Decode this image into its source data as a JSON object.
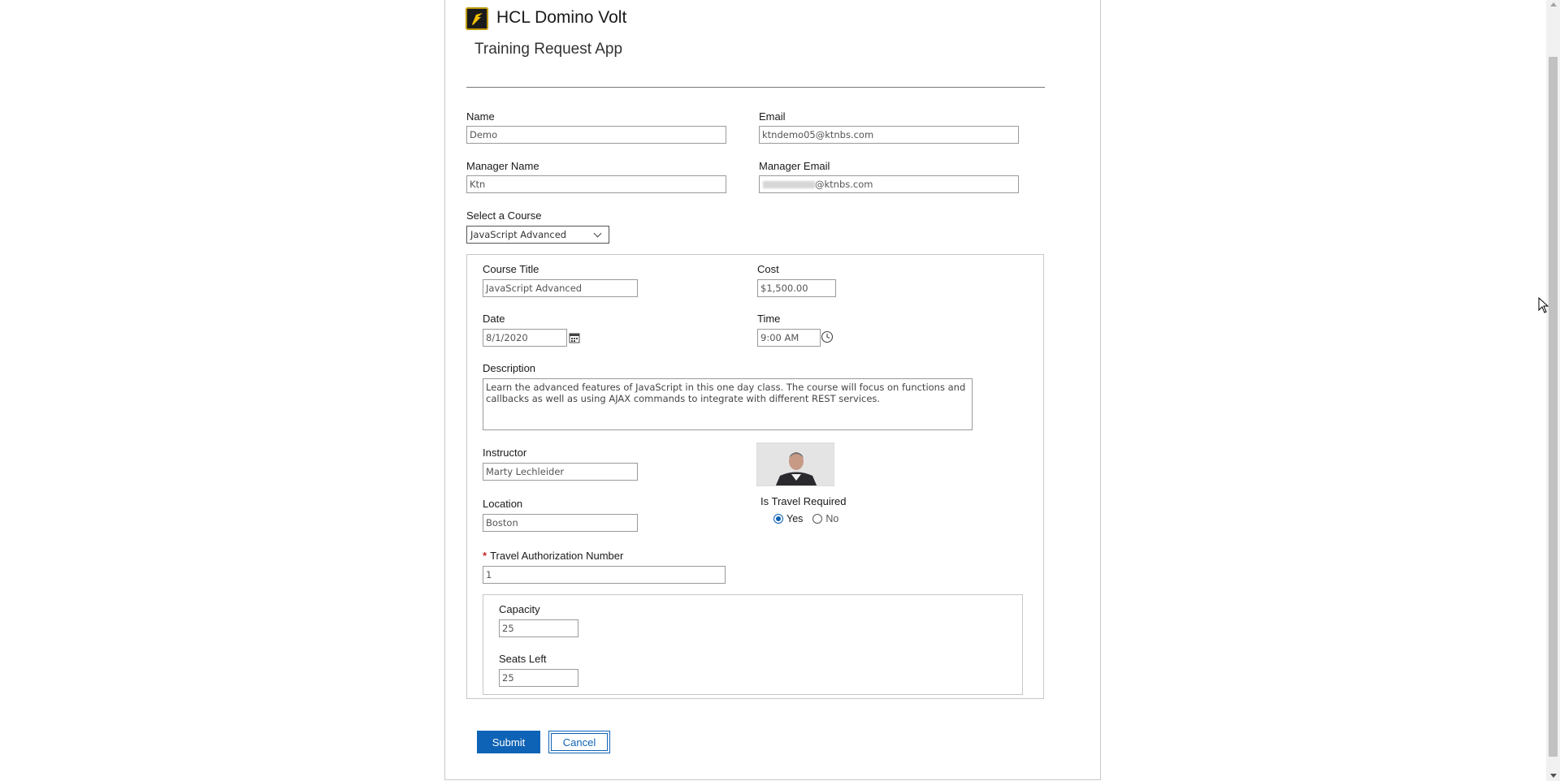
{
  "header": {
    "app_title": "HCL Domino Volt",
    "app_subtitle": "Training Request App",
    "logo_icon": "hcl-volt-logo-icon"
  },
  "form": {
    "name": {
      "label": "Name",
      "value": "Demo"
    },
    "email": {
      "label": "Email",
      "value": "ktndemo05@ktnbs.com"
    },
    "manager_name": {
      "label": "Manager Name",
      "value": "Ktn"
    },
    "manager_email": {
      "label": "Manager Email",
      "value": "@ktnbs.com"
    },
    "course_select": {
      "label": "Select a Course",
      "value": "JavaScript Advanced"
    }
  },
  "course": {
    "title": {
      "label": "Course Title",
      "value": "JavaScript Advanced"
    },
    "cost": {
      "label": "Cost",
      "value": "$1,500.00"
    },
    "date": {
      "label": "Date",
      "value": "8/1/2020"
    },
    "time": {
      "label": "Time",
      "value": "9:00 AM"
    },
    "description": {
      "label": "Description",
      "value": "Learn the advanced features of JavaScript in this one day class.  The course will focus on functions and callbacks as well as using AJAX commands to integrate with different REST services."
    },
    "instructor": {
      "label": "Instructor",
      "value": "Marty Lechleider"
    },
    "location": {
      "label": "Location",
      "value": "Boston"
    },
    "travel_required": {
      "label": "Is Travel Required",
      "options": [
        "Yes",
        "No"
      ],
      "selected": "Yes"
    },
    "travel_auth": {
      "required_mark": "*",
      "label": "Travel Authorization Number",
      "value": "1"
    },
    "capacity": {
      "label": "Capacity",
      "value": "25"
    },
    "seats_left": {
      "label": "Seats Left",
      "value": "25"
    }
  },
  "actions": {
    "submit_label": "Submit",
    "cancel_label": "Cancel"
  },
  "colors": {
    "accent": "#0f63b6",
    "required": "#c1272d",
    "logo_yellow": "#f2c100"
  }
}
